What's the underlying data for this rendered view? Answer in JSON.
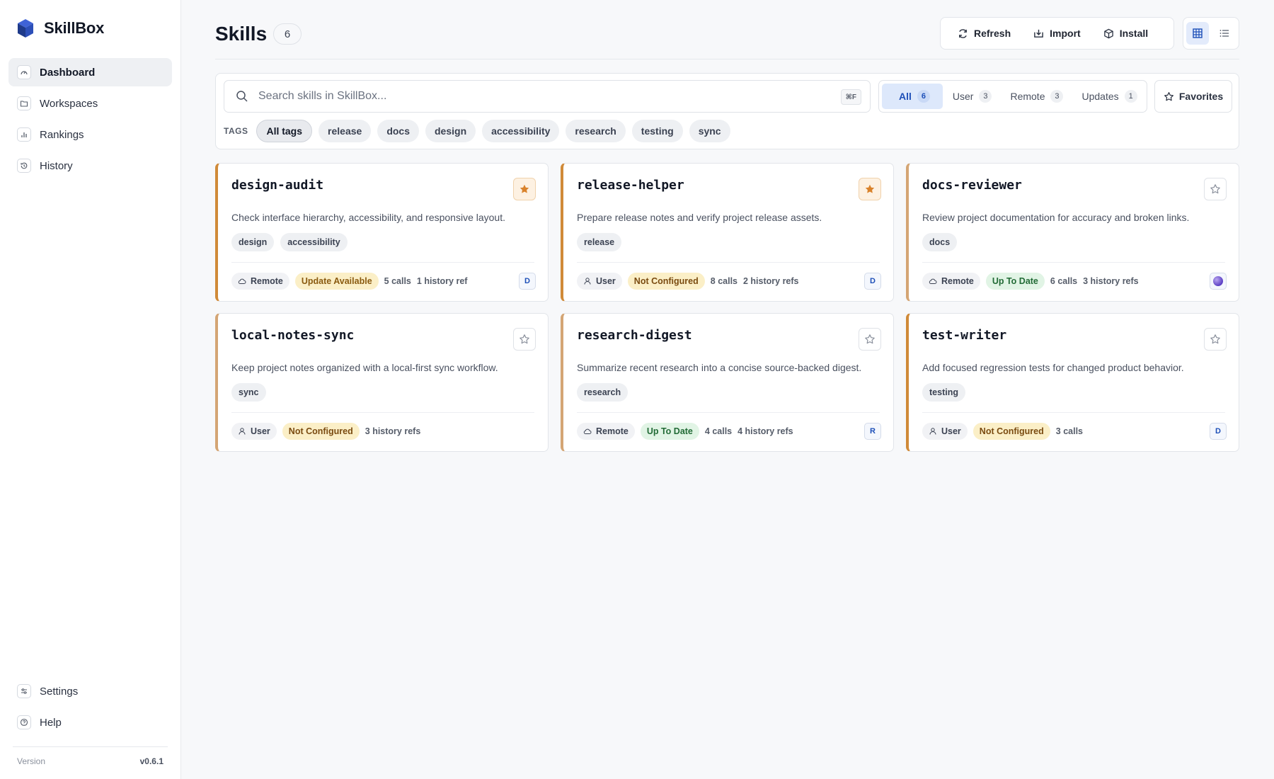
{
  "app": {
    "name": "SkillBox"
  },
  "sidebar": {
    "items": [
      {
        "label": "Dashboard",
        "icon": "gauge-icon",
        "active": true
      },
      {
        "label": "Workspaces",
        "icon": "folder-icon"
      },
      {
        "label": "Rankings",
        "icon": "bar-chart-icon"
      },
      {
        "label": "History",
        "icon": "history-icon"
      }
    ],
    "bottom_items": [
      {
        "label": "Settings",
        "icon": "sliders-icon"
      },
      {
        "label": "Help",
        "icon": "help-icon"
      }
    ],
    "version_label": "Version",
    "version_value": "v0.6.1"
  },
  "header": {
    "title": "Skills",
    "count": "6",
    "toolbar": {
      "refresh": "Refresh",
      "import": "Import",
      "install": "Install"
    },
    "view_modes": [
      "grid",
      "list"
    ]
  },
  "filters": {
    "search_placeholder": "Search skills in SkillBox...",
    "search_value": "",
    "shortcut": "⌘F",
    "scopes": [
      {
        "label": "All",
        "count": "6",
        "active": true
      },
      {
        "label": "User",
        "count": "3"
      },
      {
        "label": "Remote",
        "count": "3"
      },
      {
        "label": "Updates",
        "count": "1"
      }
    ],
    "favorites_label": "Favorites",
    "tags_label": "TAGS",
    "tags": [
      "All tags",
      "release",
      "docs",
      "design",
      "accessibility",
      "research",
      "testing",
      "sync"
    ]
  },
  "colors": {
    "accent": "#1d4fb8",
    "card_accent": "#d08a38",
    "favorite_star": "#d9822b",
    "status_ok": "#226b36",
    "status_warn": "#8a5a0f"
  },
  "skills": [
    {
      "name": "design-audit",
      "favorite": true,
      "description": "Check interface hierarchy, accessibility, and responsive layout.",
      "tags": [
        "design",
        "accessibility"
      ],
      "source": "Remote",
      "status": "Update Available",
      "calls": "5 calls",
      "refs": "1 history ref",
      "agent": "D"
    },
    {
      "name": "release-helper",
      "favorite": true,
      "description": "Prepare release notes and verify project release assets.",
      "tags": [
        "release"
      ],
      "source": "User",
      "status": "Not Configured",
      "calls": "8 calls",
      "refs": "2 history refs",
      "agent": "D"
    },
    {
      "name": "docs-reviewer",
      "favorite": false,
      "description": "Review project documentation for accuracy and broken links.",
      "tags": [
        "docs"
      ],
      "source": "Remote",
      "status": "Up To Date",
      "calls": "6 calls",
      "refs": "3 history refs",
      "agent": ""
    },
    {
      "name": "local-notes-sync",
      "favorite": false,
      "description": "Keep project notes organized with a local-first sync workflow.",
      "tags": [
        "sync"
      ],
      "source": "User",
      "status": "Not Configured",
      "calls": "",
      "refs": "3 history refs",
      "agent": ""
    },
    {
      "name": "research-digest",
      "favorite": false,
      "description": "Summarize recent research into a concise source-backed digest.",
      "tags": [
        "research"
      ],
      "source": "Remote",
      "status": "Up To Date",
      "calls": "4 calls",
      "refs": "4 history refs",
      "agent": "R"
    },
    {
      "name": "test-writer",
      "favorite": false,
      "description": "Add focused regression tests for changed product behavior.",
      "tags": [
        "testing"
      ],
      "source": "User",
      "status": "Not Configured",
      "calls": "3 calls",
      "refs": "",
      "agent": "D"
    }
  ]
}
